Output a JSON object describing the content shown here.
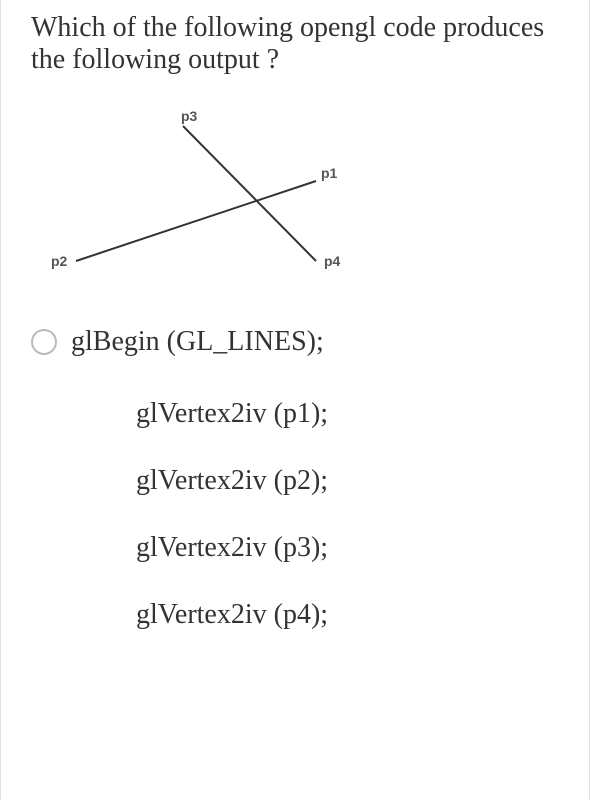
{
  "question": "Which of the following opengl code produces the following output ?",
  "diagram": {
    "labels": {
      "p1": "p1",
      "p2": "p2",
      "p3": "p3",
      "p4": "p4"
    }
  },
  "option": {
    "line0": "glBegin (GL_LINES);",
    "line1": "glVertex2iv (p1);",
    "line2": "glVertex2iv (p2);",
    "line3": "glVertex2iv (p3);",
    "line4": "glVertex2iv (p4);"
  }
}
